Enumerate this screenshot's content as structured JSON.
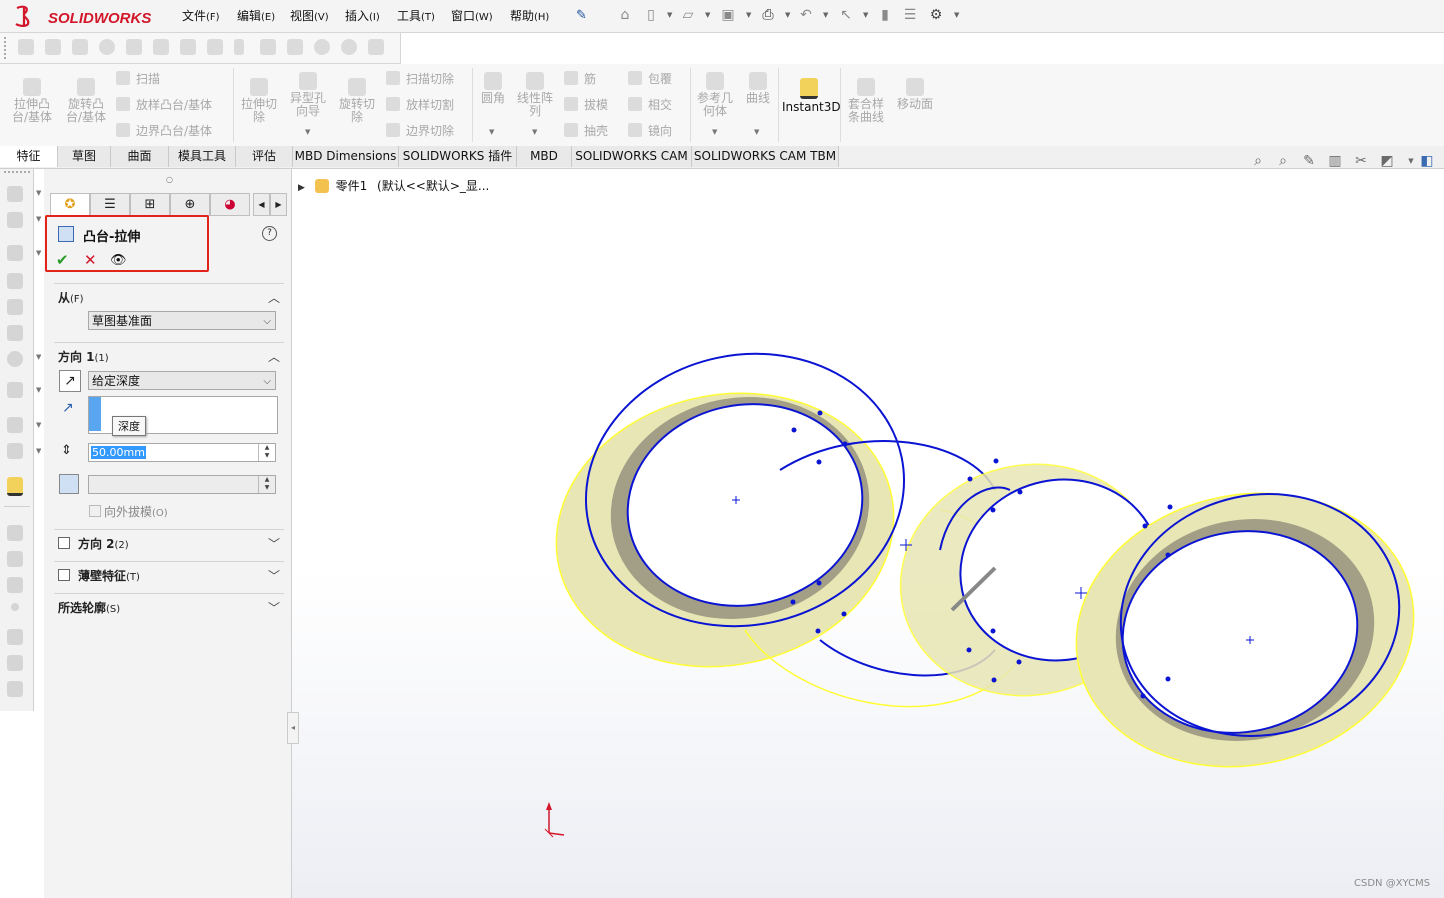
{
  "menu": {
    "logo": "SOLIDWORKS",
    "items": [
      {
        "label": "文件",
        "key": "(F)"
      },
      {
        "label": "编辑",
        "key": "(E)"
      },
      {
        "label": "视图",
        "key": "(V)"
      },
      {
        "label": "插入",
        "key": "(I)"
      },
      {
        "label": "工具",
        "key": "(T)"
      },
      {
        "label": "窗口",
        "key": "(W)"
      },
      {
        "label": "帮助",
        "key": "(H)"
      }
    ]
  },
  "command_manager": {
    "extrude_boss": "拉伸凸台/基体",
    "revolve_boss": "旋转凸台/基体",
    "sweep": "扫描",
    "loft_boss": "放样凸台/基体",
    "boundary_boss": "边界凸台/基体",
    "extrude_cut": "拉伸切除",
    "hole_wizard": "异型孔向导",
    "revolve_cut": "旋转切除",
    "sweep_cut": "扫描切除",
    "loft_cut": "放样切割",
    "boundary_cut": "边界切除",
    "fillet": "圆角",
    "linear_pattern": "线性阵列",
    "rib": "筋",
    "draft": "拔模",
    "shell": "抽壳",
    "wrap": "包覆",
    "intersect": "相交",
    "mirror": "镜向",
    "ref_geometry": "参考几何体",
    "curves": "曲线",
    "instant3d": "Instant3D",
    "spline_on_surface": "套合样条曲线",
    "move_face": "移动面"
  },
  "tabs": [
    "特征",
    "草图",
    "曲面",
    "模具工具",
    "评估",
    "MBD Dimensions",
    "SOLIDWORKS 插件",
    "MBD",
    "SOLIDWORKS CAM",
    "SOLIDWORKS CAM TBM"
  ],
  "property_manager": {
    "title": "凸台-拉伸",
    "from": {
      "label": "从",
      "key": "(F)",
      "value": "草图基准面"
    },
    "direction1": {
      "label": "方向 1",
      "key": "(1)",
      "end_condition": "给定深度",
      "tooltip": "深度",
      "depth": "50.00mm",
      "draft_outward": "向外拔模",
      "draft_key": "(O)"
    },
    "direction2": {
      "label": "方向 2",
      "key": "(2)"
    },
    "thin_feature": {
      "label": "薄壁特征",
      "key": "(T)"
    },
    "selected_contours": {
      "label": "所选轮廓",
      "key": "(S)"
    }
  },
  "tree": {
    "part": "零件1",
    "config": "(默认<<默认>_显..."
  },
  "watermark": "CSDN @XYCMS",
  "colors": {
    "ring_fill": "#e8e6b4",
    "ring_side": "#a39e86",
    "ring_edge": "#ffff33",
    "sketch_blue": "#0a14d2",
    "highlight_red": "#e2231a"
  }
}
